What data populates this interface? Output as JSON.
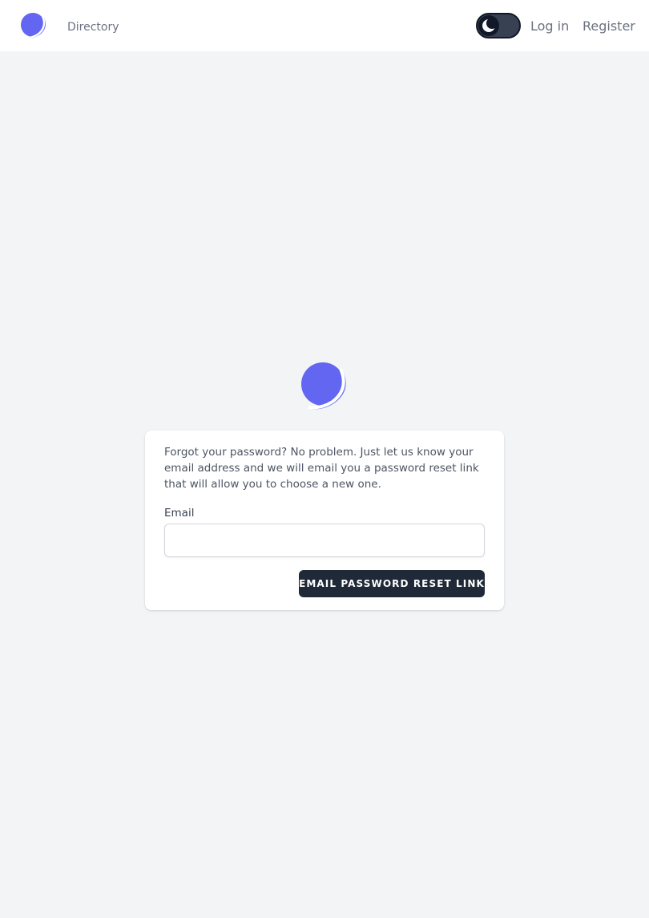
{
  "nav": {
    "logo_icon": "planet-logo-icon",
    "directory_label": "Directory",
    "theme_toggle_icon": "moon-icon",
    "login_label": "Log in",
    "register_label": "Register"
  },
  "main": {
    "logo_icon": "planet-logo-icon",
    "message": "Forgot your password? No problem. Just let us know your email address and we will email you a password reset link that will allow you to choose a new one.",
    "email_label": "Email",
    "email_value": "",
    "email_placeholder": "",
    "submit_label": "Email Password Reset Link"
  },
  "colors": {
    "brand": "#6366f1",
    "background": "#f3f4f6",
    "button": "#1f2937",
    "nav_text": "#6b7280"
  }
}
